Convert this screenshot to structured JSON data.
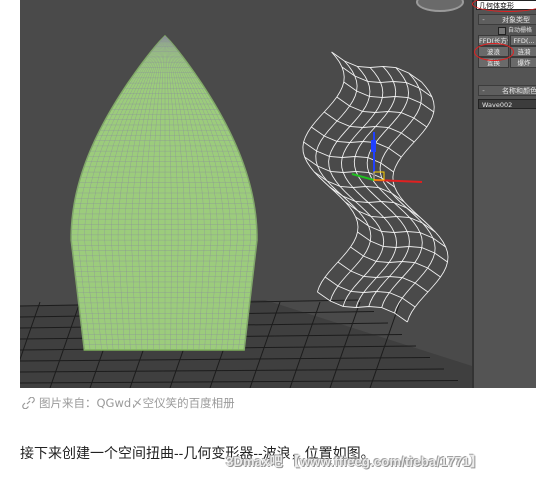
{
  "panel": {
    "geometry_dropdown": "几何体变形",
    "object_type_rollout": {
      "toggle": "-",
      "title": "对象类型"
    },
    "auto_grid": "自动栅格",
    "buttons": [
      "FFD(长方体)",
      "FFD(...",
      "波浪",
      "置换",
      "涟漪",
      "爆炸"
    ],
    "name_color_rollout": {
      "toggle": "-",
      "title": "名称和颜色"
    },
    "name_value": "Wave002"
  },
  "caption": "图片来自：QGwd〆空仪笑的百度相册",
  "body_text": "接下来创建一个空间扭曲--几何变形器--波浪，位置如图。",
  "watermark": "3Dmax吧 【www.ffieeg.com/tieba/1771】",
  "colors": {
    "viewport_bg": "#4a4a4a",
    "mesh_green": "#9ccc7c",
    "wire_white": "#f0f0f0",
    "highlight_red": "#e02020",
    "panel_bg": "#545454"
  },
  "icons": {
    "caption_link": "link-icon",
    "gizmo": "transform-gizmo-icon"
  }
}
